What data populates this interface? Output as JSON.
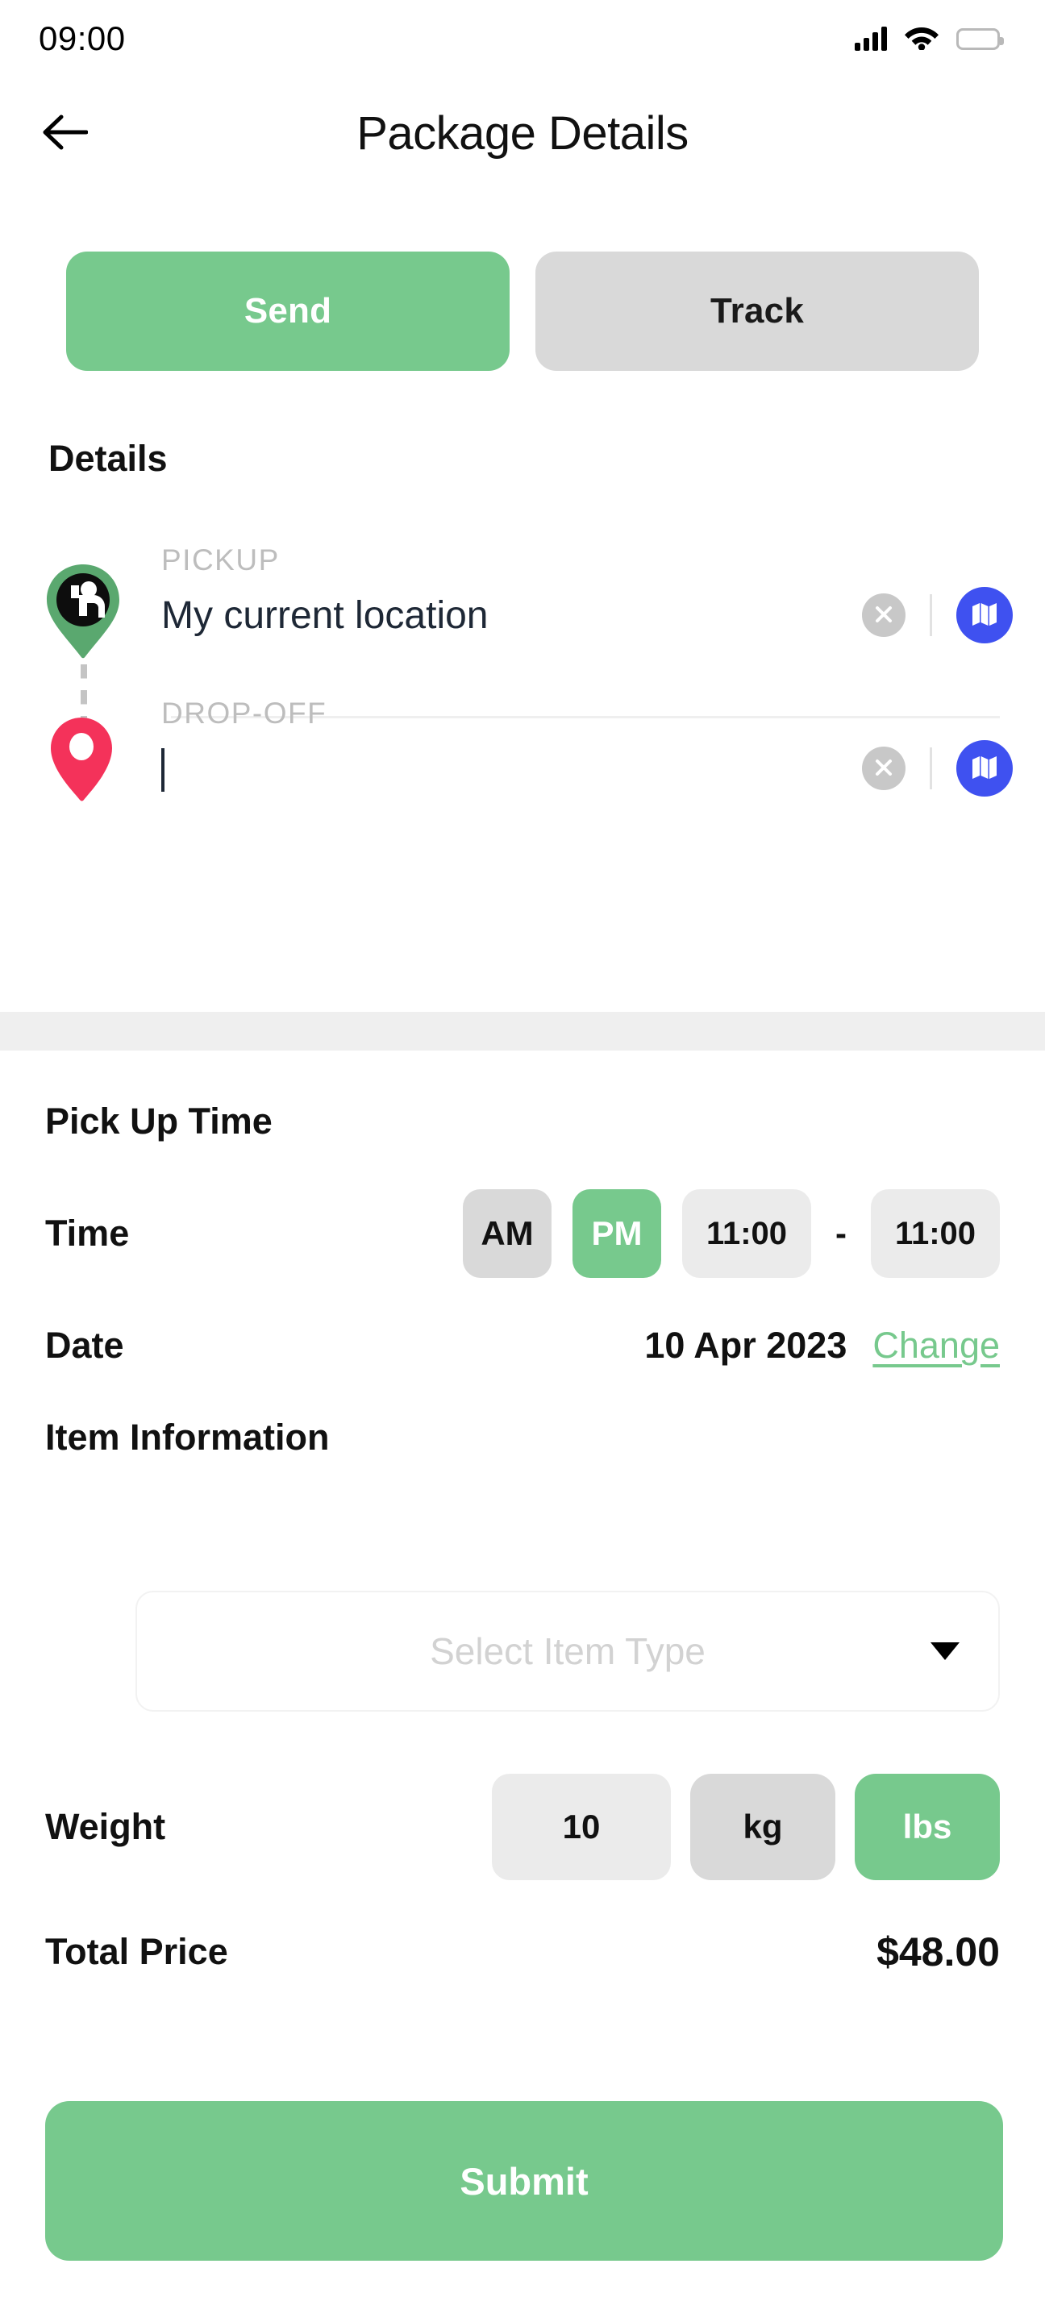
{
  "status_bar": {
    "time": "09:00",
    "signal_icon": "signal-bars-icon",
    "wifi_icon": "wifi-icon",
    "battery_icon": "battery-full-icon"
  },
  "header": {
    "back_icon": "back-arrow-icon",
    "title": "Package Details"
  },
  "tabs": {
    "send_label": "Send",
    "track_label": "Track",
    "active": "Send"
  },
  "details": {
    "heading": "Details",
    "pickup": {
      "label": "PICKUP",
      "value": "My current location",
      "pin_icon": "pickup-person-pin-icon",
      "clear_icon": "clear-x-icon",
      "map_icon": "map-icon"
    },
    "dropoff": {
      "label": "DROP-OFF",
      "value": "",
      "pin_icon": "location-pin-icon",
      "clear_icon": "clear-x-icon",
      "map_icon": "map-icon"
    }
  },
  "pickup_time": {
    "title": "Pick Up Time",
    "time_label": "Time",
    "am_label": "AM",
    "pm_label": "PM",
    "meridiem_active": "PM",
    "time_from": "11:00",
    "time_separator": "-",
    "time_to": "11:00",
    "date_label": "Date",
    "date_value": "10 Apr 2023",
    "change_label": "Change"
  },
  "item_information": {
    "title": "Item Information",
    "select_placeholder": "Select Item Type",
    "dropdown_icon": "chevron-down-icon"
  },
  "weight": {
    "label": "Weight",
    "value": "10",
    "kg_label": "kg",
    "lbs_label": "lbs",
    "active_unit": "lbs"
  },
  "total": {
    "label": "Total Price",
    "value": "$48.00"
  },
  "submit": {
    "label": "Submit"
  },
  "colors": {
    "accent_green": "#77c98d",
    "inactive_gray": "#d9d9d9",
    "field_gray": "#ebebeb",
    "map_blue": "#3f51f0",
    "pin_red": "#f4325a",
    "text_dark": "#1e2836",
    "placeholder_gray": "#d2d2d2"
  }
}
